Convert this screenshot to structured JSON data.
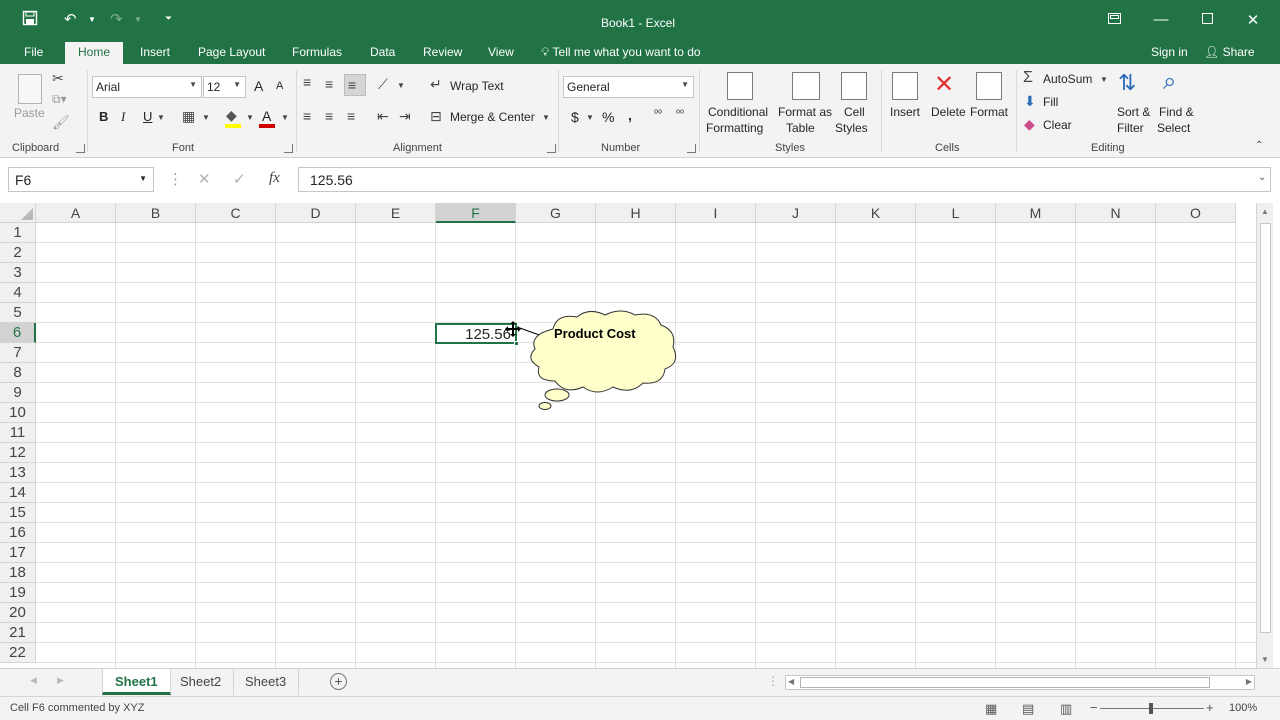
{
  "window": {
    "title": "Book1 - Excel"
  },
  "quick_access": {
    "save_icon": "save-icon",
    "undo_icon": "undo-icon",
    "redo_icon": "redo-icon",
    "customize_icon": "customize-qat-icon"
  },
  "tabs": {
    "file": "File",
    "home": "Home",
    "insert": "Insert",
    "page_layout": "Page Layout",
    "formulas": "Formulas",
    "data": "Data",
    "review": "Review",
    "view": "View",
    "tell_me": "Tell me what you want to do",
    "sign_in": "Sign in",
    "share": "Share"
  },
  "ribbon": {
    "clipboard": {
      "label": "Clipboard",
      "paste": "Paste"
    },
    "font": {
      "label": "Font",
      "name": "Arial",
      "size": "12",
      "bold": "B",
      "italic": "I",
      "underline": "U",
      "grow": "A",
      "shrink": "A",
      "color_letter": "A"
    },
    "alignment": {
      "label": "Alignment",
      "wrap": "Wrap Text",
      "merge": "Merge & Center"
    },
    "number": {
      "label": "Number",
      "format": "General",
      "currency": "$",
      "percent": "%",
      "comma": ",",
      "inc_dec": "⁰⁰",
      "dec_dec": "⁰⁰"
    },
    "styles": {
      "label": "Styles",
      "conditional1": "Conditional",
      "conditional2": "Formatting",
      "format_table1": "Format as",
      "format_table2": "Table",
      "cell_styles1": "Cell",
      "cell_styles2": "Styles"
    },
    "cells": {
      "label": "Cells",
      "insert": "Insert",
      "delete": "Delete",
      "format": "Format"
    },
    "editing": {
      "label": "Editing",
      "autosum": "AutoSum",
      "fill": "Fill",
      "clear": "Clear",
      "sort1": "Sort &",
      "sort2": "Filter",
      "find1": "Find &",
      "find2": "Select"
    }
  },
  "formula_bar": {
    "name_box": "F6",
    "formula": "125.56",
    "fx": "fx",
    "cancel": "✕",
    "enter": "✓"
  },
  "grid": {
    "columns": [
      "A",
      "B",
      "C",
      "D",
      "E",
      "F",
      "G",
      "H",
      "I",
      "J",
      "K",
      "L",
      "M",
      "N",
      "O"
    ],
    "rows": [
      "1",
      "2",
      "3",
      "4",
      "5",
      "6",
      "7",
      "8",
      "9",
      "10",
      "11",
      "12",
      "13",
      "14",
      "15",
      "16",
      "17",
      "18",
      "19",
      "20",
      "21",
      "22"
    ],
    "active_cell_value": "125.56",
    "comment_text": "Product Cost"
  },
  "sheets": {
    "sheet1": "Sheet1",
    "sheet2": "Sheet2",
    "sheet3": "Sheet3",
    "add": "+"
  },
  "status": {
    "message": "Cell F6 commented by XYZ",
    "zoom": "100%",
    "zoom_minus": "−",
    "zoom_plus": "+"
  }
}
